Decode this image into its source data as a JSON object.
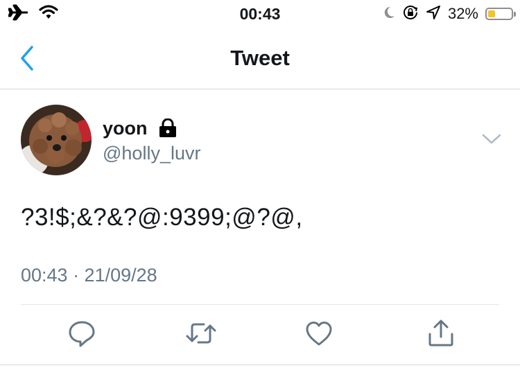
{
  "status_bar": {
    "time": "00:43",
    "battery_percent": "32%",
    "battery_level": 0.32,
    "left_icons": [
      "airplane-icon",
      "wifi-icon"
    ],
    "right_icons": [
      "moon-icon",
      "rotation-lock-icon",
      "location-arrow-icon",
      "battery-icon"
    ]
  },
  "nav": {
    "title": "Tweet",
    "back_icon": "chevron-left-icon"
  },
  "tweet": {
    "author_name": "yoon",
    "author_handle": "@holly_luvr",
    "protected_icon": "lock-icon",
    "text": "?3!$;&?&?@:9399;@?@,",
    "timestamp": "00:43 · 21/09/28"
  },
  "actions": [
    {
      "icon": "reply-icon"
    },
    {
      "icon": "retweet-icon"
    },
    {
      "icon": "like-icon"
    },
    {
      "icon": "share-icon"
    }
  ],
  "colors": {
    "accent": "#1da1f2",
    "secondary_text": "#657786",
    "icon_gray": "#657786",
    "battery_fill": "#f5c42c"
  }
}
